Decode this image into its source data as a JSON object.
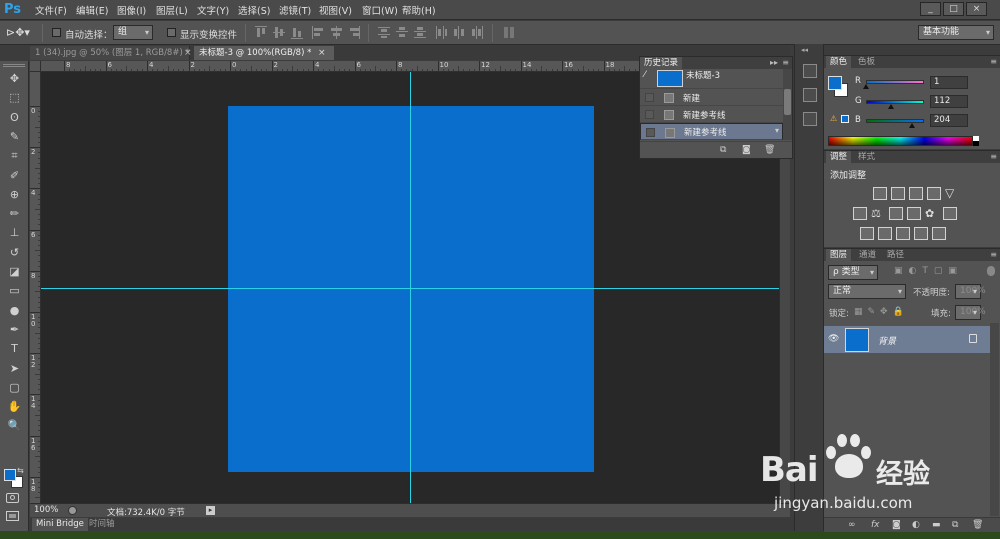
{
  "menubar": {
    "logo": "Ps",
    "items": [
      "文件(F)",
      "编辑(E)",
      "图像(I)",
      "图层(L)",
      "文字(Y)",
      "选择(S)",
      "滤镜(T)",
      "视图(V)",
      "窗口(W)",
      "帮助(H)"
    ],
    "window_controls": [
      "_",
      "□",
      "×"
    ]
  },
  "options": {
    "auto_select_label": "自动选择：",
    "auto_select_value": "组",
    "show_transform_label": "显示变换控件",
    "workspace": "基本功能"
  },
  "tabs": [
    {
      "label": "1 (34).jpg @ 50% (图层 1, RGB/8#) *",
      "close": "×"
    },
    {
      "label": "未标题-3 @ 100%(RGB/8) *",
      "close": "×"
    }
  ],
  "ruler_top": [
    "8",
    "6",
    "4",
    "2",
    "0",
    "2",
    "4",
    "6",
    "8",
    "10",
    "12",
    "14",
    "16",
    "18",
    "20",
    "22",
    "24"
  ],
  "ruler_left": [
    "0",
    "2",
    "4",
    "6",
    "8",
    "1 0",
    "1 2",
    "1 4",
    "1 6",
    "1 8"
  ],
  "tools": [
    "move",
    "marquee",
    "lasso",
    "quick-select",
    "crop",
    "eyedropper",
    "spot-heal",
    "brush",
    "stamp",
    "history-brush",
    "eraser",
    "gradient",
    "dodge",
    "pen",
    "type",
    "path-select",
    "shape",
    "hand",
    "zoom"
  ],
  "tool_glyphs": [
    "✥",
    "⬚",
    "ʘ",
    "✎",
    "⌗",
    "✐",
    "⊕",
    "✏",
    "⊥",
    "↺",
    "◪",
    "▭",
    "●",
    "✒",
    "T",
    "➤",
    "▢",
    "✋",
    "🔍"
  ],
  "colors": {
    "foreground": "#0a6ecc",
    "background": "#ffffff",
    "document_fill": "#0a6ecc",
    "guide": "#2ad4e6"
  },
  "status": {
    "zoom": "100%",
    "doc_info": "文档:732.4K/0 字节"
  },
  "bottom_tabs": [
    "Mini Bridge",
    "时间轴"
  ],
  "history": {
    "title": "历史记录",
    "snapshot_label": "未标题-3",
    "items": [
      "新建",
      "新建参考线",
      "新建参考线"
    ]
  },
  "color_panel": {
    "tabs": [
      "颜色",
      "色板"
    ],
    "r_label": "R",
    "g_label": "G",
    "b_label": "B",
    "r": 1,
    "g": 112,
    "b": 204
  },
  "adjust_panel": {
    "tabs": [
      "调整",
      "样式"
    ],
    "title": "添加调整"
  },
  "layers_panel": {
    "tabs": [
      "图层",
      "通道",
      "路径"
    ],
    "kind_filter": "ρ 类型",
    "blend_mode": "正常",
    "opacity_label": "不透明度:",
    "opacity_value": "100%",
    "lock_label": "锁定:",
    "fill_label": "填充:",
    "fill_value": "100%",
    "layer_name": "背景"
  },
  "watermark": {
    "brand": "Bai",
    "brand_suffix": "经验",
    "url": "jingyan.baidu.com"
  }
}
